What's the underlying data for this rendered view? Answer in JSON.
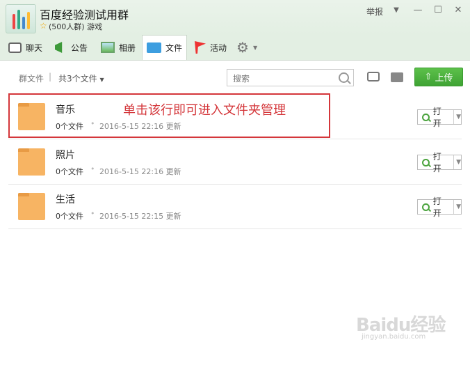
{
  "window": {
    "group_name": "百度经验测试用群",
    "group_sub": "(500人群) 游戏",
    "report_label": "举报",
    "menu_glyph": "▼",
    "minimize_glyph": "—",
    "maximize_glyph": "☐",
    "close_glyph": "✕"
  },
  "tabs": [
    {
      "label": "聊天"
    },
    {
      "label": "公告"
    },
    {
      "label": "相册"
    },
    {
      "label": "文件"
    },
    {
      "label": "活动"
    }
  ],
  "toolbar": {
    "crumb": "群文件",
    "separator": "|",
    "count_label": "共3个文件",
    "search_placeholder": "搜索",
    "upload_label": "上传"
  },
  "files": [
    {
      "name": "音乐",
      "count": "0个文件",
      "date": "2016-5-15 22:16 更新",
      "open_label": "打开"
    },
    {
      "name": "照片",
      "count": "0个文件",
      "date": "2016-5-15 22:16 更新",
      "open_label": "打开"
    },
    {
      "name": "生活",
      "count": "0个文件",
      "date": "2016-5-15 22:15 更新",
      "open_label": "打开"
    }
  ],
  "annotation": {
    "text": "单击该行即可进入文件夹管理"
  },
  "watermark": {
    "text": "Baidu经验",
    "sub": "jingyan.baidu.com"
  },
  "colors": {
    "accent_green": "#4aa33d",
    "annotation_red": "#d4363a",
    "folder_orange": "#f7b463"
  }
}
